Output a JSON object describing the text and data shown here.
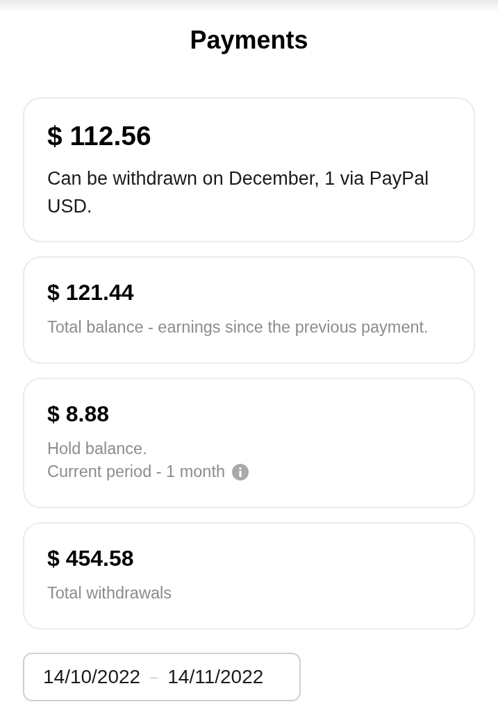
{
  "title": "Payments",
  "cards": [
    {
      "kind": "main",
      "amount": "$ 112.56",
      "lines": [
        {
          "text": "Can be withdrawn on December, 1 via PayPal USD.",
          "info": false
        }
      ]
    },
    {
      "kind": "detail",
      "amount": "$ 121.44",
      "lines": [
        {
          "text": "Total balance - earnings since the previous payment.",
          "info": false
        }
      ]
    },
    {
      "kind": "detail",
      "amount": "$ 8.88",
      "lines": [
        {
          "text": "Hold balance.",
          "info": false
        },
        {
          "text": "Current period - 1 month",
          "info": true
        }
      ]
    },
    {
      "kind": "detail",
      "amount": "$ 454.58",
      "lines": [
        {
          "text": "Total withdrawals",
          "info": false
        }
      ]
    }
  ],
  "date_range": {
    "start": "14/10/2022",
    "separator": "–",
    "end": "14/11/2022"
  }
}
